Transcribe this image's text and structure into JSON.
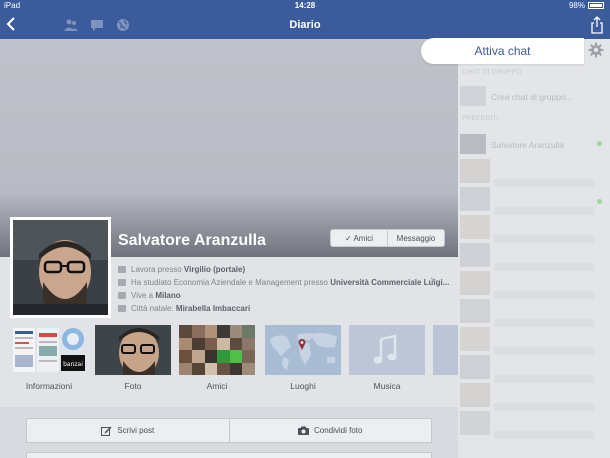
{
  "status": {
    "device": "iPad",
    "time": "14:28",
    "battery": "98%"
  },
  "nav": {
    "title": "Diario",
    "icons": [
      "back-chevron-icon",
      "friend-requests-icon",
      "messages-icon",
      "notifications-globe-icon",
      "share-icon"
    ]
  },
  "profile": {
    "name": "Salvatore Aranzulla",
    "friends_button": "✓ Amici",
    "message_button": "Messaggio",
    "info": [
      {
        "prefix": "Lavora presso ",
        "value": "Virgilio (portale)",
        "suffix": ""
      },
      {
        "prefix": "Ha studiato Economia Aziendale e Management presso ",
        "value": "Università Commerciale Luigi...",
        "suffix": ""
      },
      {
        "prefix": "Vive a ",
        "value": "Milano",
        "suffix": ""
      },
      {
        "prefix": "Città natale: ",
        "value": "Mirabella Imbaccari",
        "suffix": ""
      }
    ]
  },
  "tiles": [
    {
      "label": "Informazioni",
      "icon": "info-collage-icon"
    },
    {
      "label": "Foto",
      "icon": "photo-portrait-icon"
    },
    {
      "label": "Amici",
      "icon": "friends-mosaic-icon"
    },
    {
      "label": "Luoghi",
      "icon": "world-map-pin-icon"
    },
    {
      "label": "Musica",
      "icon": "music-note-icon"
    }
  ],
  "post_bar": {
    "write": "Scrivi post",
    "share_photo": "Condividi foto"
  },
  "chat": {
    "toggle_label": "Attiva chat",
    "section_groups": "CHAT DI GRUPPO",
    "create_group": "Crea chat di gruppo...",
    "section_favorites": "PREFERITI",
    "contact": "Salvatore Aranzulla"
  },
  "colors": {
    "facebook_blue": "#3b5b9a",
    "chat_bg": "#e4e5e9",
    "online_green": "#9fd79a"
  }
}
